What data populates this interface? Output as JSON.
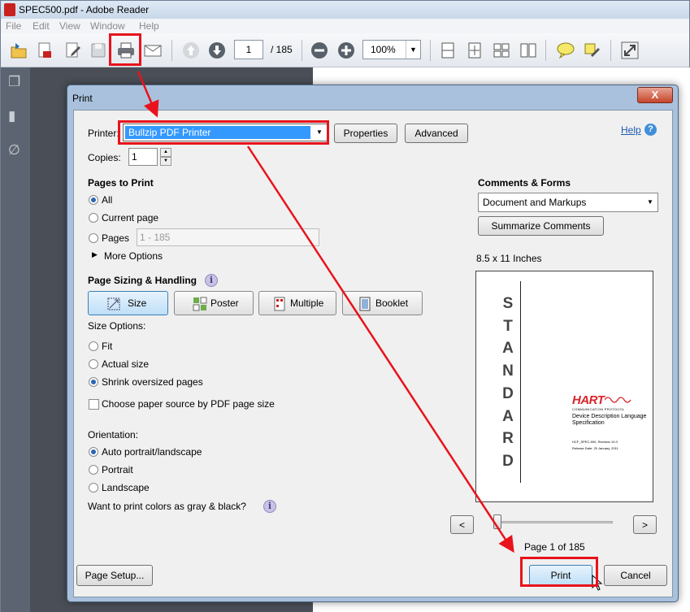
{
  "window": {
    "title": "SPEC500.pdf - Adobe Reader"
  },
  "menu": [
    "File",
    "Edit",
    "View",
    "Window",
    "Help"
  ],
  "toolbar": {
    "current_page": "1",
    "total_pages": "/ 185",
    "zoom": "100%"
  },
  "dialog": {
    "title": "Print",
    "close": "X",
    "help": "Help",
    "printer_label": "Printer:",
    "printer_value": "Bullzip PDF Printer",
    "properties": "Properties",
    "advanced": "Advanced",
    "copies_label": "Copies:",
    "copies_value": "1",
    "pages_heading": "Pages to Print",
    "pages_all": "All",
    "pages_current": "Current page",
    "pages_pages": "Pages",
    "pages_range_placeholder": "1 - 185",
    "more_options": "More Options",
    "sizing_heading": "Page Sizing & Handling",
    "seg_size": "Size",
    "seg_poster": "Poster",
    "seg_multiple": "Multiple",
    "seg_booklet": "Booklet",
    "size_options": "Size Options:",
    "opt_fit": "Fit",
    "opt_actual": "Actual size",
    "opt_shrink": "Shrink oversized pages",
    "paper_source": "Choose paper source by PDF page size",
    "orientation": "Orientation:",
    "orient_auto": "Auto portrait/landscape",
    "orient_portrait": "Portrait",
    "orient_landscape": "Landscape",
    "gray_question": "Want to print colors as gray & black?",
    "comments_heading": "Comments & Forms",
    "comments_value": "Document and Markups",
    "summarize": "Summarize Comments",
    "paper_size": "8.5 x 11 Inches",
    "preview": {
      "standard_letters": [
        "S",
        "T",
        "A",
        "N",
        "D",
        "A",
        "R",
        "D"
      ],
      "logo": "HART",
      "logo_sub": "COMMUNICATION PROTOCOL",
      "doc_title": "Device Description Language Specification",
      "doc_code": "HCF_SPEC-500, Revision 10.0",
      "doc_date": "Release Date: 25 January, 2011"
    },
    "nav_prev": "<",
    "nav_next": ">",
    "page_indicator": "Page 1 of 185",
    "page_setup": "Page Setup...",
    "print": "Print",
    "cancel": "Cancel"
  },
  "colors": {
    "annotation_red": "#e8131c",
    "selection_blue": "#3399ff"
  }
}
